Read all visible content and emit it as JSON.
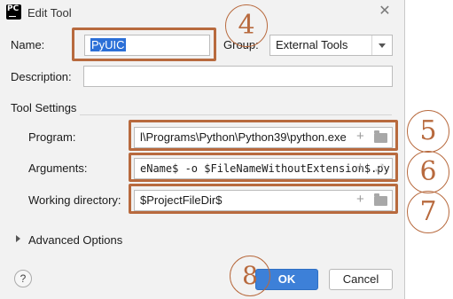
{
  "window": {
    "title": "Edit Tool",
    "icon_text": "PC",
    "close_icon": "close-icon"
  },
  "form": {
    "name_label": "Name:",
    "name_value": "PyUIC",
    "group_label": "Group:",
    "group_value": "External Tools",
    "description_label": "Description:",
    "description_value": ""
  },
  "tool_settings": {
    "section_label": "Tool Settings",
    "program_label": "Program:",
    "program_value": "l\\Programs\\Python\\Python39\\python.exe",
    "arguments_label": "Arguments:",
    "arguments_value": "eName$ -o $FileNameWithoutExtension$.py",
    "working_dir_label": "Working directory:",
    "working_dir_value": "$ProjectFileDir$"
  },
  "advanced": {
    "label": "Advanced Options"
  },
  "buttons": {
    "help_label": "?",
    "ok_label": "OK",
    "cancel_label": "Cancel"
  },
  "annotations": {
    "color": "#b86a3e",
    "markers": [
      "④",
      "⑤",
      "⑥",
      "⑦",
      "⑧"
    ]
  }
}
